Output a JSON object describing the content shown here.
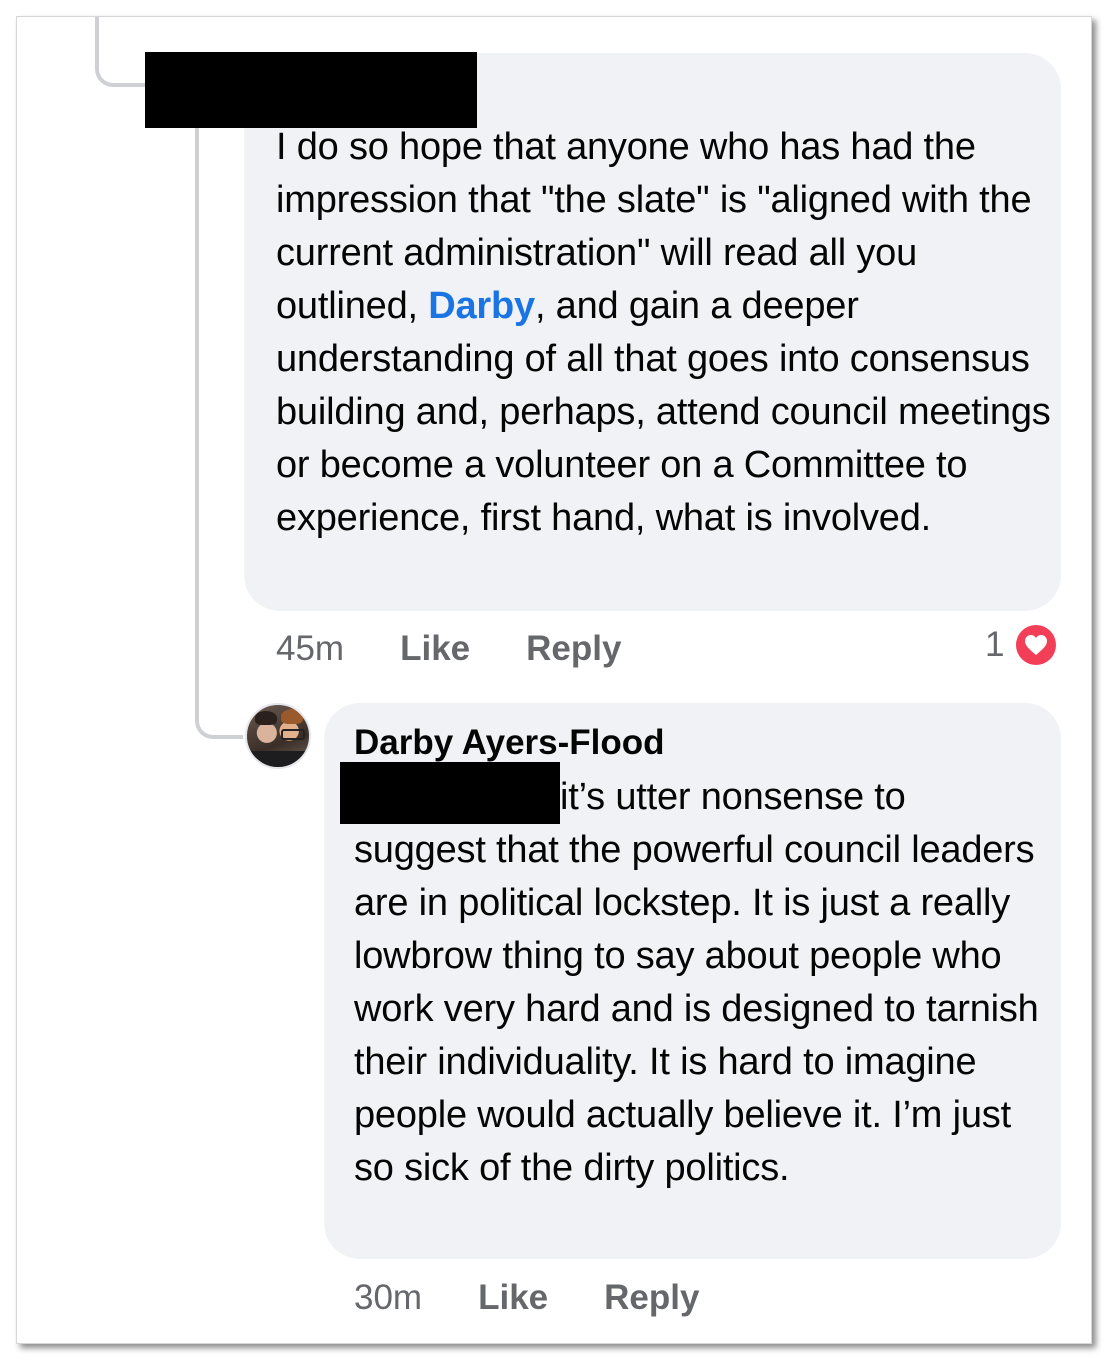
{
  "comments": [
    {
      "author": "",
      "text_before_mention": "I do so hope that anyone who has had the impression that \"the slate\" is \"aligned with the current administration\" will read all you outlined, ",
      "mention": "Darby",
      "text_after_mention": ", and gain a deeper understanding of all that goes into consensus building and, perhaps, attend council meetings or become a volunteer on a Committee to experience, first hand, what is involved.",
      "time": "45m",
      "like_label": "Like",
      "reply_label": "Reply",
      "reaction_count": "1",
      "reaction_icon": "heart-icon"
    },
    {
      "author": "Darby Ayers-Flood",
      "text": "it’s utter nonsense to suggest that the powerful council leaders are in political lockstep. It is just a really lowbrow thing to say about people who work very hard and is designed to tarnish their individuality. It is hard to imagine people would actually believe it. I’m just so sick of the dirty politics.",
      "time": "30m",
      "like_label": "Like",
      "reply_label": "Reply"
    }
  ],
  "colors": {
    "bubble": "#f0f2f5",
    "mention": "#1b74e4",
    "meta": "#65676b",
    "heart": "#f33e58",
    "redaction": "#000000"
  }
}
